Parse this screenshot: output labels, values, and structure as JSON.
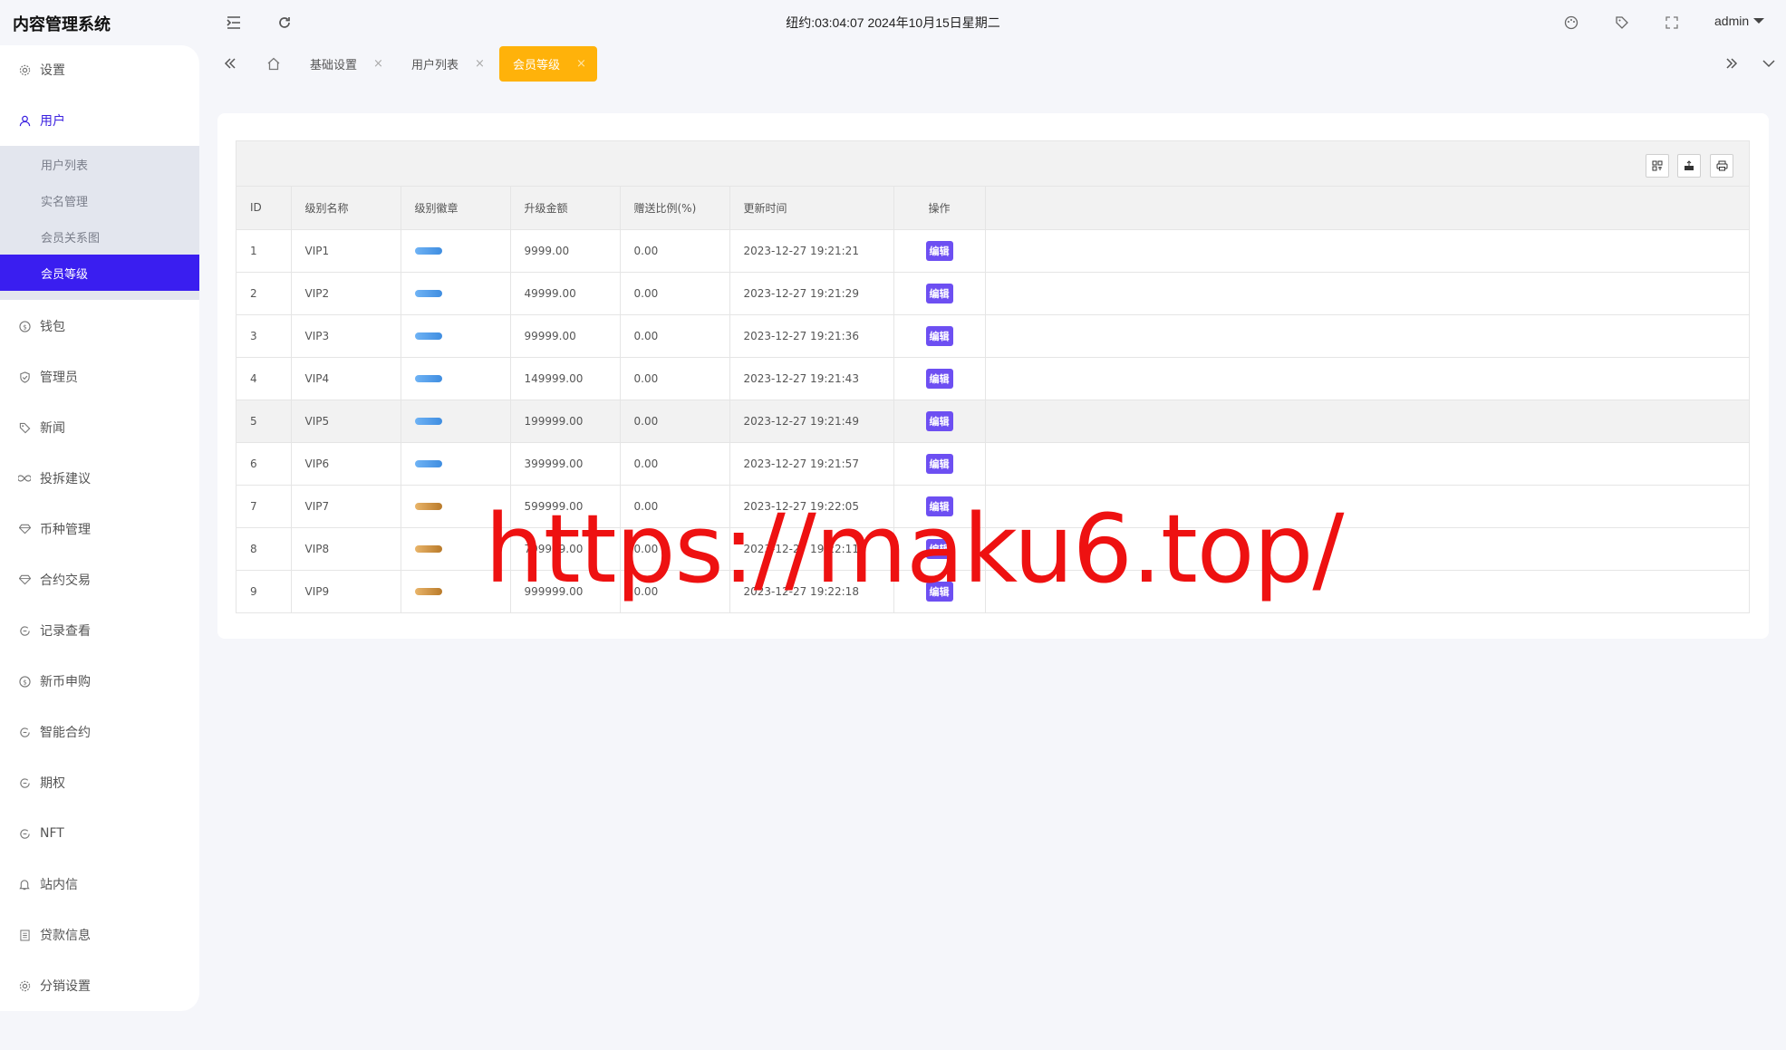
{
  "app": {
    "title": "内容管理系统"
  },
  "header": {
    "clock": "纽约:03:04:07 2024年10月15日星期二",
    "user": "admin"
  },
  "sidebar": {
    "items": [
      {
        "label": "设置",
        "icon": "gear-icon"
      },
      {
        "label": "用户",
        "icon": "user-icon"
      },
      {
        "label": "钱包",
        "icon": "dollar-icon"
      },
      {
        "label": "管理员",
        "icon": "shield-icon"
      },
      {
        "label": "新闻",
        "icon": "tag-icon"
      },
      {
        "label": "投拆建议",
        "icon": "infinity-icon"
      },
      {
        "label": "币种管理",
        "icon": "diamond-icon"
      },
      {
        "label": "合约交易",
        "icon": "diamond-icon"
      },
      {
        "label": "记录查看",
        "icon": "cycle-icon"
      },
      {
        "label": "新币申购",
        "icon": "dollar-icon"
      },
      {
        "label": "智能合约",
        "icon": "cycle-icon"
      },
      {
        "label": "期权",
        "icon": "cycle-icon"
      },
      {
        "label": "NFT",
        "icon": "cycle-icon"
      },
      {
        "label": "站内信",
        "icon": "bell-icon"
      },
      {
        "label": "贷款信息",
        "icon": "document-icon"
      },
      {
        "label": "分销设置",
        "icon": "gear-icon"
      }
    ],
    "user_submenu": [
      "用户列表",
      "实名管理",
      "会员关系图",
      "会员等级"
    ]
  },
  "tabs": [
    {
      "label": "基础设置"
    },
    {
      "label": "用户列表"
    },
    {
      "label": "会员等级"
    }
  ],
  "table": {
    "columns": [
      "ID",
      "级别名称",
      "级别徽章",
      "升级金额",
      "赠送比例(%)",
      "更新时间",
      "操作"
    ],
    "edit_label": "编辑",
    "rows": [
      {
        "id": "1",
        "name": "VIP1",
        "badge": "blue",
        "amount": "9999.00",
        "ratio": "0.00",
        "time": "2023-12-27 19:21:21"
      },
      {
        "id": "2",
        "name": "VIP2",
        "badge": "blue",
        "amount": "49999.00",
        "ratio": "0.00",
        "time": "2023-12-27 19:21:29"
      },
      {
        "id": "3",
        "name": "VIP3",
        "badge": "blue",
        "amount": "99999.00",
        "ratio": "0.00",
        "time": "2023-12-27 19:21:36"
      },
      {
        "id": "4",
        "name": "VIP4",
        "badge": "blue",
        "amount": "149999.00",
        "ratio": "0.00",
        "time": "2023-12-27 19:21:43"
      },
      {
        "id": "5",
        "name": "VIP5",
        "badge": "blue",
        "amount": "199999.00",
        "ratio": "0.00",
        "time": "2023-12-27 19:21:49"
      },
      {
        "id": "6",
        "name": "VIP6",
        "badge": "blue",
        "amount": "399999.00",
        "ratio": "0.00",
        "time": "2023-12-27 19:21:57"
      },
      {
        "id": "7",
        "name": "VIP7",
        "badge": "gold",
        "amount": "599999.00",
        "ratio": "0.00",
        "time": "2023-12-27 19:22:05"
      },
      {
        "id": "8",
        "name": "VIP8",
        "badge": "gold",
        "amount": "799999.00",
        "ratio": "0.00",
        "time": "2023-12-27 19:22:11"
      },
      {
        "id": "9",
        "name": "VIP9",
        "badge": "gold",
        "amount": "999999.00",
        "ratio": "0.00",
        "time": "2023-12-27 19:22:18"
      }
    ]
  },
  "watermark": "https://maku6.top/",
  "colors": {
    "accent": "#3a1ef0",
    "tab_active": "#ffb20a",
    "edit_button": "#6d4ff2",
    "watermark": "#ee1111"
  }
}
